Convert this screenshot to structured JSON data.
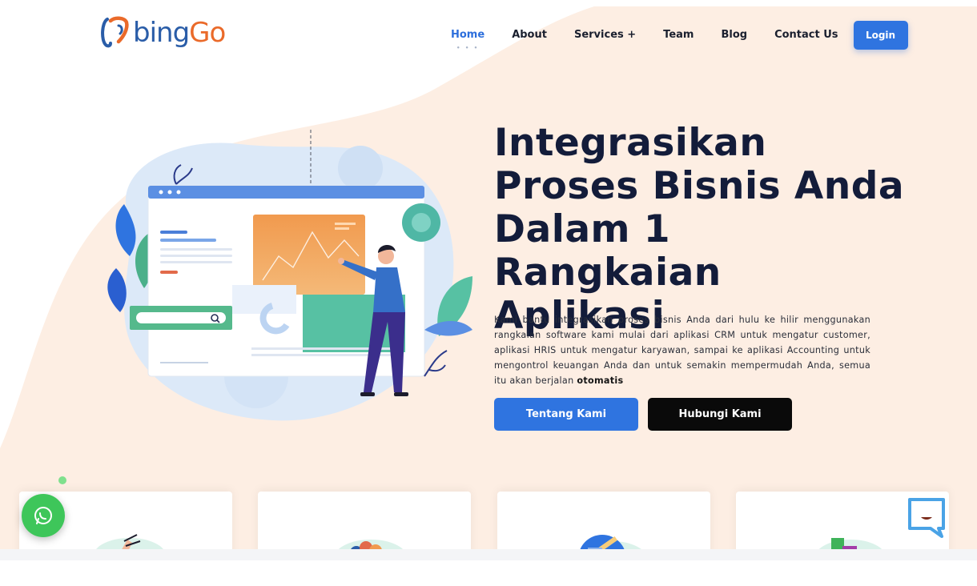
{
  "brand": {
    "logo_text_b": "bing",
    "logo_text_go": "Go",
    "primary_color": "#2f74e0",
    "accent_color": "#ea6a2a",
    "dark_color": "#131c3a",
    "hero_bg_color": "#fdeee3"
  },
  "nav": {
    "items": [
      {
        "label": "Home",
        "active": true
      },
      {
        "label": "About"
      },
      {
        "label": "Services +"
      },
      {
        "label": "Team"
      },
      {
        "label": "Blog"
      },
      {
        "label": "Contact Us"
      }
    ],
    "active_indicator": "• • •",
    "login_label": "Login"
  },
  "hero": {
    "title_lines": [
      "Integrasikan",
      "Proses Bisnis Anda",
      "Dalam 1 Rangkaian",
      "Aplikasi"
    ],
    "description": "Kami bantu integrasikan proses bisnis Anda dari hulu ke hilir menggunakan rangkaian software kami mulai dari aplikasi CRM untuk mengatur customer, aplikasi HRIS untuk mengatur karyawan, sampai ke aplikasi Accounting untuk mengontrol keuangan Anda dan untuk semakin mempermudah Anda, semua itu akan berjalan",
    "description_bold": "otomatis",
    "primary_button": "Tentang Kami",
    "secondary_button": "Hubungi Kami"
  },
  "illustration": {
    "icons": [
      "browser-window",
      "analytics-chart",
      "search-bar",
      "presenter-person",
      "gear",
      "plant-leaves"
    ]
  },
  "cards": [
    {
      "icon": "hand-pointer-icon"
    },
    {
      "icon": "app-bubbles-icon"
    },
    {
      "icon": "pencil-tools-icon"
    },
    {
      "icon": "puzzle-pieces-icon"
    }
  ],
  "floating": {
    "whatsapp_icon": "whatsapp-icon",
    "chat_icon": "chat-bubble-icon"
  }
}
